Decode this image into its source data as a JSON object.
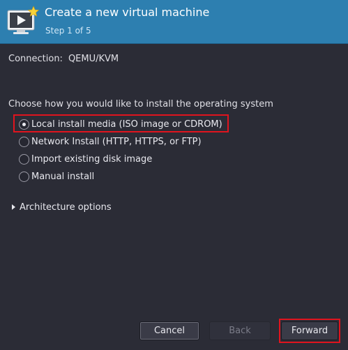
{
  "header": {
    "title": "Create a new virtual machine",
    "subtitle": "Step 1 of 5",
    "icon": "monitor-play-star-icon"
  },
  "connection": {
    "label": "Connection:",
    "value": "QEMU/KVM"
  },
  "install": {
    "prompt": "Choose how you would like to install the operating system",
    "options": [
      {
        "label": "Local install media (ISO image or CDROM)",
        "selected": true
      },
      {
        "label": "Network Install (HTTP, HTTPS, or FTP)",
        "selected": false
      },
      {
        "label": "Import existing disk image",
        "selected": false
      },
      {
        "label": "Manual install",
        "selected": false
      }
    ]
  },
  "architecture": {
    "label": "Architecture options"
  },
  "buttons": {
    "cancel": "Cancel",
    "back": "Back",
    "forward": "Forward"
  },
  "colors": {
    "header_bg": "#2d7fb0",
    "window_bg": "#2b2c36",
    "highlight": "#e0141e"
  }
}
